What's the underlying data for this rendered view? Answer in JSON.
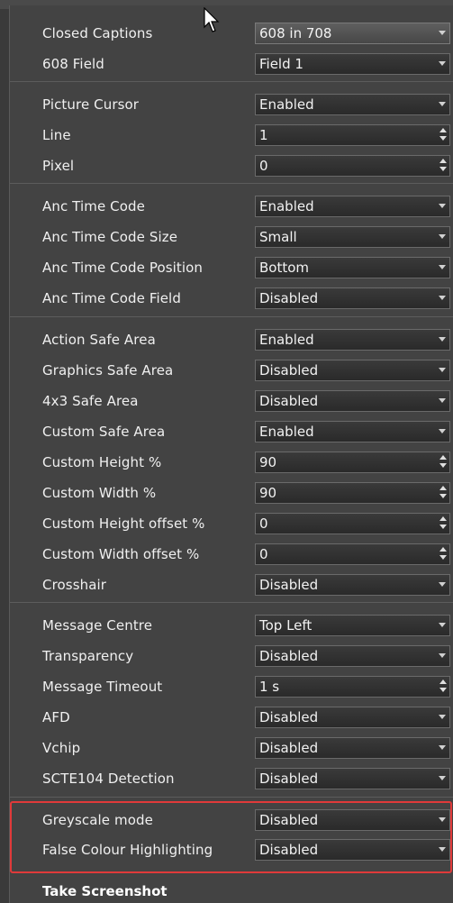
{
  "colors": {
    "panel_bg": "#434343",
    "control_bg": "#2e2e2e",
    "text": "#f0f0f0",
    "highlight_border": "#e03a3a"
  },
  "rows": [
    {
      "label": "Closed Captions",
      "value": "608 in 708",
      "type": "dropdown",
      "selected": true
    },
    {
      "label": "608 Field",
      "value": "Field 1",
      "type": "dropdown"
    },
    {
      "label": "Picture Cursor",
      "value": "Enabled",
      "type": "dropdown"
    },
    {
      "label": "Line",
      "value": "1",
      "type": "spinner"
    },
    {
      "label": "Pixel",
      "value": "0",
      "type": "spinner"
    },
    {
      "label": "Anc Time Code",
      "value": "Enabled",
      "type": "dropdown"
    },
    {
      "label": "Anc Time Code Size",
      "value": "Small",
      "type": "dropdown"
    },
    {
      "label": "Anc Time Code Position",
      "value": "Bottom",
      "type": "dropdown"
    },
    {
      "label": "Anc Time Code Field",
      "value": "Disabled",
      "type": "dropdown"
    },
    {
      "label": "Action Safe Area",
      "value": "Enabled",
      "type": "dropdown"
    },
    {
      "label": "Graphics Safe Area",
      "value": "Disabled",
      "type": "dropdown"
    },
    {
      "label": "4x3 Safe Area",
      "value": "Disabled",
      "type": "dropdown"
    },
    {
      "label": "Custom Safe Area",
      "value": "Enabled",
      "type": "dropdown"
    },
    {
      "label": "Custom Height %",
      "value": "90",
      "type": "spinner"
    },
    {
      "label": "Custom Width %",
      "value": "90",
      "type": "spinner"
    },
    {
      "label": "Custom Height offset %",
      "value": "0",
      "type": "spinner"
    },
    {
      "label": "Custom Width offset %",
      "value": "0",
      "type": "spinner"
    },
    {
      "label": "Crosshair",
      "value": "Disabled",
      "type": "dropdown"
    },
    {
      "label": "Message Centre",
      "value": "Top Left",
      "type": "dropdown"
    },
    {
      "label": "Transparency",
      "value": "Disabled",
      "type": "dropdown"
    },
    {
      "label": "Message Timeout",
      "value": "1 s",
      "type": "spinner"
    },
    {
      "label": "AFD",
      "value": "Disabled",
      "type": "dropdown"
    },
    {
      "label": "Vchip",
      "value": "Disabled",
      "type": "dropdown"
    },
    {
      "label": "SCTE104 Detection",
      "value": "Disabled",
      "type": "dropdown"
    },
    {
      "label": "Greyscale mode",
      "value": "Disabled",
      "type": "dropdown"
    },
    {
      "label": "False Colour Highlighting",
      "value": "Disabled",
      "type": "dropdown"
    }
  ],
  "footer": {
    "take_screenshot_label": "Take Screenshot"
  }
}
